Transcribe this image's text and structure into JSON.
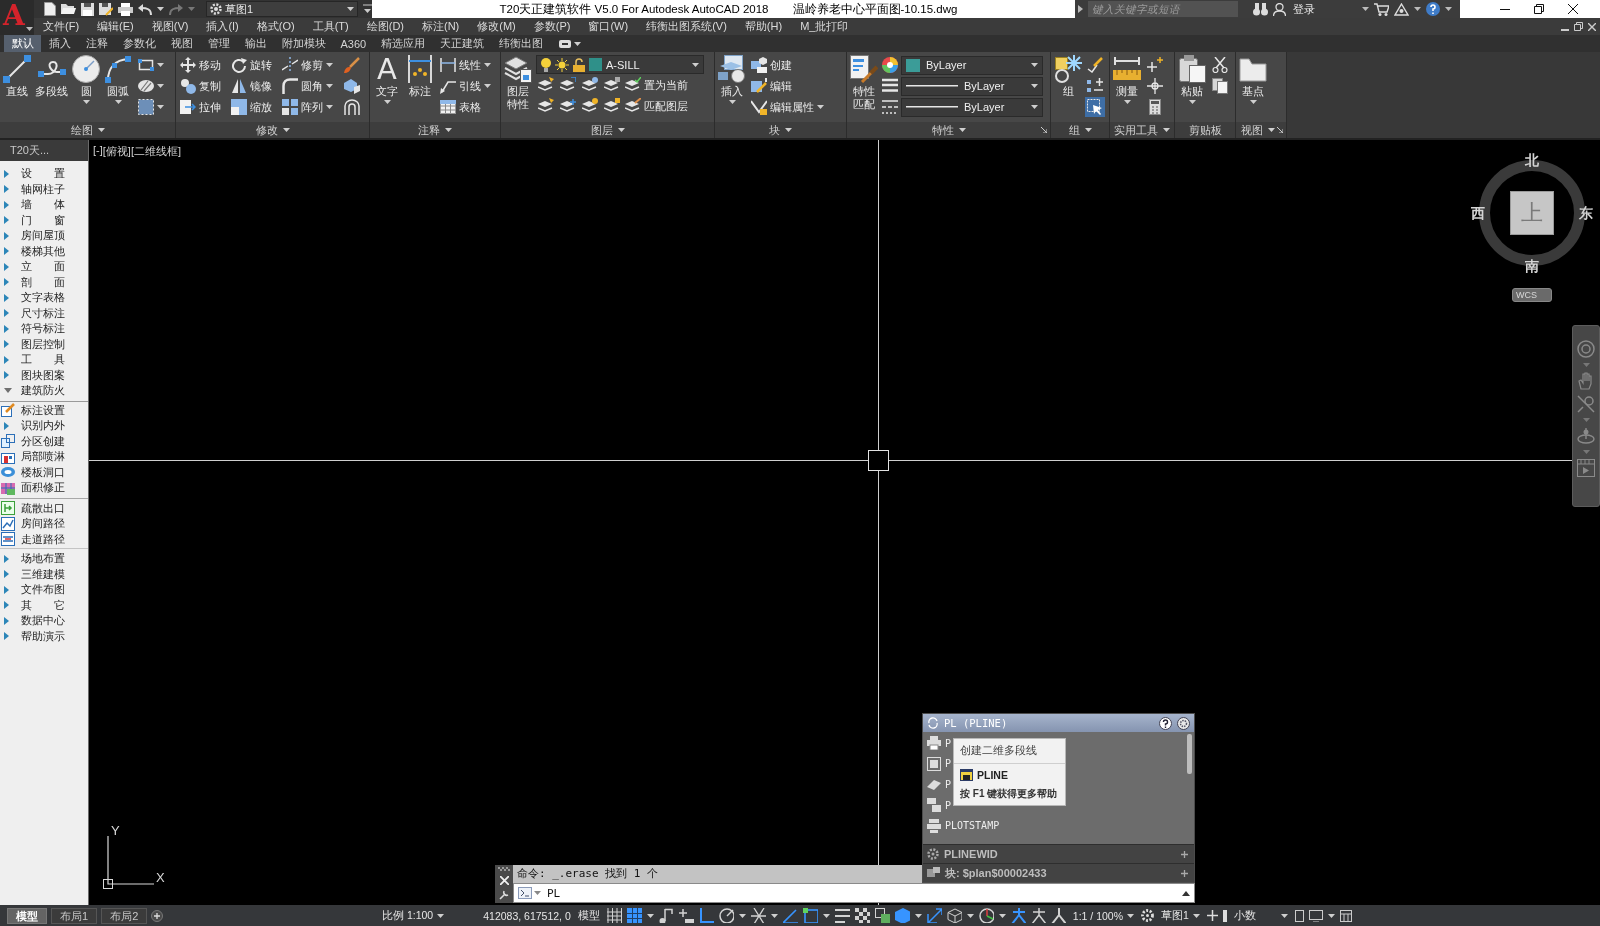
{
  "title_bar": {
    "app_logo": "A",
    "workspace": "草图1",
    "title": "T20天正建筑软件 V5.0 For Autodesk AutoCAD 2018",
    "document": "温岭养老中心平面图-10.15.dwg",
    "search": {
      "placeholder": "键入关键字或短语"
    },
    "sign_in": "登录"
  },
  "menu_bar": {
    "items": [
      "文件(F)",
      "编辑(E)",
      "视图(V)",
      "插入(I)",
      "格式(O)",
      "工具(T)",
      "绘图(D)",
      "标注(N)",
      "修改(M)",
      "参数(P)",
      "窗口(W)",
      "纬衡出图系统(V)",
      "帮助(H)",
      "M_批打印"
    ]
  },
  "ribbon": {
    "tabs": [
      {
        "label": "默认",
        "selected": true
      },
      {
        "label": "插入",
        "selected": false
      },
      {
        "label": "注释",
        "selected": false
      },
      {
        "label": "参数化",
        "selected": false
      },
      {
        "label": "视图",
        "selected": false
      },
      {
        "label": "管理",
        "selected": false
      },
      {
        "label": "输出",
        "selected": false
      },
      {
        "label": "附加模块",
        "selected": false
      },
      {
        "label": "A360",
        "selected": false
      },
      {
        "label": "精选应用",
        "selected": false
      },
      {
        "label": "天正建筑",
        "selected": false
      },
      {
        "label": "纬衡出图",
        "selected": false
      }
    ],
    "panels": [
      {
        "title": "绘图",
        "menu": true,
        "launcher": false,
        "items": [
          {
            "kind": "large",
            "label": "直线",
            "menu": false
          },
          {
            "kind": "large",
            "label": "多段线",
            "menu": false
          },
          {
            "kind": "large",
            "label": "圆",
            "menu": true
          },
          {
            "kind": "large",
            "label": "圆弧",
            "menu": true
          },
          {
            "kind": "stack",
            "items": [
              {
                "kind": "icon",
                "menu": true
              },
              {
                "kind": "icon",
                "menu": true
              },
              {
                "kind": "icon",
                "menu": true
              }
            ]
          }
        ]
      },
      {
        "title": "修改",
        "menu": true,
        "launcher": false,
        "items": [
          {
            "kind": "stack",
            "items": [
              {
                "kind": "tool",
                "label": "移动",
                "menu": false
              },
              {
                "kind": "tool",
                "label": "复制",
                "menu": false
              },
              {
                "kind": "tool",
                "label": "拉伸",
                "menu": false
              }
            ]
          },
          {
            "kind": "stack",
            "items": [
              {
                "kind": "tool",
                "label": "旋转",
                "menu": false
              },
              {
                "kind": "tool",
                "label": "镜像",
                "menu": false
              },
              {
                "kind": "tool",
                "label": "缩放",
                "menu": false
              }
            ]
          },
          {
            "kind": "stack",
            "items": [
              {
                "kind": "tool",
                "label": "修剪",
                "menu": true
              },
              {
                "kind": "tool",
                "label": "圆角",
                "menu": true
              },
              {
                "kind": "tool",
                "label": "阵列",
                "menu": true
              }
            ]
          },
          {
            "kind": "stack",
            "items": [
              {
                "kind": "icon",
                "menu": false
              },
              {
                "kind": "icon",
                "menu": false
              },
              {
                "kind": "icon",
                "menu": false
              }
            ]
          }
        ]
      },
      {
        "title": "注释",
        "menu": true,
        "launcher": false,
        "items": [
          {
            "kind": "large",
            "label": "文字",
            "glyph": "A",
            "menu": true
          },
          {
            "kind": "large",
            "label": "标注",
            "menu": false
          },
          {
            "kind": "stack",
            "items": [
              {
                "kind": "tool",
                "label": "线性",
                "menu": true
              },
              {
                "kind": "tool",
                "label": "引线",
                "menu": true
              },
              {
                "kind": "tool",
                "label": "表格",
                "menu": false
              }
            ]
          }
        ]
      },
      {
        "title": "图层",
        "menu": true,
        "launcher": false,
        "items": [
          {
            "kind": "large",
            "label": "图层特性",
            "menu": false
          },
          {
            "kind": "stack",
            "items": [
              {
                "kind": "layer_select",
                "value": "A-SILL",
                "color": "#2f9089"
              },
              {
                "kind": "row",
                "items": [
                  {
                    "kind": "icon",
                    "menu": false
                  },
                  {
                    "kind": "icon",
                    "menu": false
                  },
                  {
                    "kind": "icon",
                    "menu": false
                  },
                  {
                    "kind": "icon",
                    "menu": false
                  },
                  {
                    "kind": "tool",
                    "label": "置为当前",
                    "menu": false
                  }
                ]
              },
              {
                "kind": "row",
                "items": [
                  {
                    "kind": "icon",
                    "menu": false
                  },
                  {
                    "kind": "icon",
                    "menu": false
                  },
                  {
                    "kind": "icon",
                    "menu": false
                  },
                  {
                    "kind": "icon",
                    "menu": false
                  },
                  {
                    "kind": "tool",
                    "label": "匹配图层",
                    "menu": false
                  }
                ]
              }
            ]
          }
        ]
      },
      {
        "title": "块",
        "menu": true,
        "launcher": false,
        "items": [
          {
            "kind": "large",
            "label": "插入",
            "menu": true
          },
          {
            "kind": "stack",
            "items": [
              {
                "kind": "tool",
                "label": "创建",
                "menu": false
              },
              {
                "kind": "tool",
                "label": "编辑",
                "menu": false
              },
              {
                "kind": "tool",
                "label": "编辑属性",
                "menu": true
              }
            ]
          }
        ]
      },
      {
        "title": "特性",
        "menu": true,
        "launcher": true,
        "items": [
          {
            "kind": "large",
            "label": "特性匹配",
            "menu": false
          },
          {
            "kind": "stack",
            "items": [
              {
                "kind": "swatch_select",
                "value": "ByLayer",
                "color": "#3b9c98"
              },
              {
                "kind": "line_select",
                "value": "ByLayer"
              },
              {
                "kind": "line_select",
                "value": "ByLayer"
              }
            ]
          }
        ]
      },
      {
        "title": "组",
        "menu": true,
        "launcher": false,
        "items": [
          {
            "kind": "large",
            "label": "组",
            "menu": false
          },
          {
            "kind": "stack",
            "items": [
              {
                "kind": "icon",
                "menu": false,
                "on": false
              },
              {
                "kind": "icon",
                "menu": false,
                "on": false
              },
              {
                "kind": "icon",
                "menu": false,
                "on": true
              }
            ]
          }
        ]
      },
      {
        "title": "实用工具",
        "menu": true,
        "launcher": false,
        "items": [
          {
            "kind": "large",
            "label": "测量",
            "menu": true
          },
          {
            "kind": "stack",
            "items": [
              {
                "kind": "icon",
                "menu": false
              },
              {
                "kind": "icon",
                "menu": false
              },
              {
                "kind": "icon",
                "menu": false
              }
            ]
          }
        ]
      },
      {
        "title": "剪贴板",
        "menu": false,
        "launcher": false,
        "items": [
          {
            "kind": "large",
            "label": "粘贴",
            "menu": true
          },
          {
            "kind": "stack",
            "items": [
              {
                "kind": "icon",
                "menu": false
              },
              {
                "kind": "icon",
                "menu": false
              }
            ]
          }
        ]
      },
      {
        "title": "视图",
        "menu": true,
        "launcher": true,
        "items": [
          {
            "kind": "large",
            "label": "基点",
            "menu": true
          }
        ]
      }
    ]
  },
  "screen_menu": {
    "title": "T20天...",
    "items": [
      {
        "label": "设　　置",
        "expanded": false
      },
      {
        "label": "轴网柱子",
        "expanded": false
      },
      {
        "label": "墙　　体",
        "expanded": false
      },
      {
        "label": "门　　窗",
        "expanded": false
      },
      {
        "label": "房间屋顶",
        "expanded": false
      },
      {
        "label": "楼梯其他",
        "expanded": false
      },
      {
        "label": "立　　面",
        "expanded": false
      },
      {
        "label": "剖　　面",
        "expanded": false
      },
      {
        "label": "文字表格",
        "expanded": false
      },
      {
        "label": "尺寸标注",
        "expanded": false
      },
      {
        "label": "符号标注",
        "expanded": false
      },
      {
        "label": "图层控制",
        "expanded": false
      },
      {
        "label": "工　　具",
        "expanded": false
      },
      {
        "label": "图块图案",
        "expanded": false
      },
      {
        "label": "建筑防火",
        "expanded": true,
        "children": [
          {
            "kind": "command",
            "label": "标注设置"
          },
          {
            "kind": "submenu",
            "label": "识别内外",
            "expanded": false
          },
          {
            "kind": "command",
            "label": "分区创建"
          },
          {
            "kind": "command",
            "label": "局部喷淋"
          },
          {
            "kind": "command",
            "label": "楼板洞口"
          },
          {
            "kind": "command",
            "label": "面积修正"
          },
          {
            "kind": "separator"
          },
          {
            "kind": "command",
            "label": "疏散出口"
          },
          {
            "kind": "command",
            "label": "房间路径"
          },
          {
            "kind": "command",
            "label": "走道路径"
          }
        ]
      },
      {
        "label": "场地布置",
        "expanded": false
      },
      {
        "label": "三维建模",
        "expanded": false
      },
      {
        "label": "文件布图",
        "expanded": false
      },
      {
        "label": "其　　它",
        "expanded": false
      },
      {
        "label": "数据中心",
        "expanded": false
      },
      {
        "label": "帮助演示",
        "expanded": false
      }
    ]
  },
  "viewport": {
    "controls": [
      "[-]",
      "[俯视]",
      "[二维线框]"
    ],
    "viewcube": {
      "north": "北",
      "east": "东",
      "south": "南",
      "west": "西",
      "face": "上",
      "coordinate_system": "WCS"
    },
    "ucs_icon": {
      "x": "X",
      "y": "Y"
    }
  },
  "autocomplete": {
    "title": "PL (PLINE)",
    "items": [
      {
        "label": "P"
      },
      {
        "label": "P"
      },
      {
        "label": "P"
      },
      {
        "label": "P"
      },
      {
        "label": "PLOTSTAMP"
      }
    ],
    "tooltip": {
      "description": "创建二维多段线",
      "command": "PLINE",
      "help": "按 F1 键获得更多帮助"
    },
    "categories": [
      {
        "label": "PLINEWID"
      },
      {
        "label": "块: $plan$00002433"
      }
    ]
  },
  "command_line": {
    "history": "命令: _.erase 找到 1 个",
    "input": {
      "value": "PL"
    }
  },
  "layout_tabs": [
    {
      "label": "模型",
      "selected": true
    },
    {
      "label": "布局1",
      "selected": false
    },
    {
      "label": "布局2",
      "selected": false
    }
  ],
  "status_bar": {
    "scale": "比例 1:100",
    "coordinates": "412083, 617512, 0",
    "space": "模型",
    "controls": [
      {
        "kind": "toggle",
        "on": false
      },
      {
        "kind": "toggle",
        "on": true
      },
      {
        "kind": "menu"
      },
      {
        "kind": "toggle",
        "on": false
      },
      {
        "kind": "toggle",
        "on": false
      },
      {
        "kind": "toggle",
        "on": true
      },
      {
        "kind": "toggle",
        "on": false
      },
      {
        "kind": "menu"
      },
      {
        "kind": "toggle",
        "on": false
      },
      {
        "kind": "menu"
      },
      {
        "kind": "toggle",
        "on": true
      },
      {
        "kind": "toggle",
        "on": true
      },
      {
        "kind": "menu"
      },
      {
        "kind": "toggle",
        "on": false
      },
      {
        "kind": "toggle",
        "on": false
      },
      {
        "kind": "toggle",
        "on": false
      },
      {
        "kind": "toggle",
        "on": true
      },
      {
        "kind": "menu"
      },
      {
        "kind": "toggle",
        "on": true
      },
      {
        "kind": "toggle",
        "on": false
      },
      {
        "kind": "menu"
      },
      {
        "kind": "toggle",
        "on": false
      },
      {
        "kind": "menu"
      },
      {
        "kind": "toggle",
        "on": true
      },
      {
        "kind": "toggle",
        "on": false
      },
      {
        "kind": "toggle",
        "on": false
      }
    ],
    "annotation_scale": "1:1 / 100%",
    "workspace": "草图1",
    "units": "小数"
  }
}
